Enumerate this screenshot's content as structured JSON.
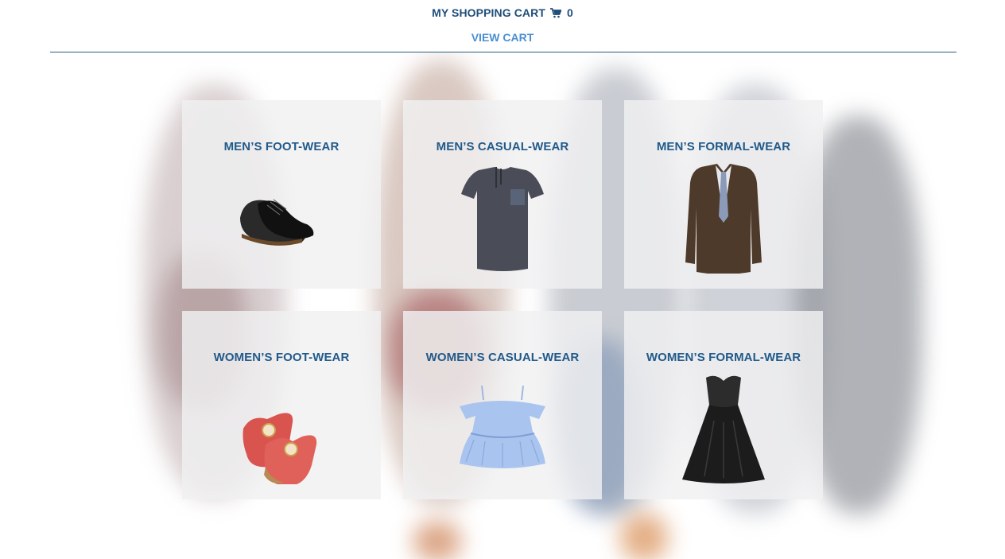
{
  "header": {
    "cart_label": "MY SHOPPING CART",
    "cart_icon": "shopping-cart-icon",
    "cart_count": "0",
    "view_cart_label": "VIEW CART"
  },
  "categories": [
    {
      "title": "MEN’S FOOT-WEAR",
      "image": "mens-shoes"
    },
    {
      "title": "MEN’S CASUAL-WEAR",
      "image": "mens-tshirt"
    },
    {
      "title": "MEN’S FORMAL-WEAR",
      "image": "mens-suit"
    },
    {
      "title": "WOMEN’S FOOT-WEAR",
      "image": "womens-shoes"
    },
    {
      "title": "WOMEN’S CASUAL-WEAR",
      "image": "womens-top"
    },
    {
      "title": "WOMEN’S FORMAL-WEAR",
      "image": "womens-gown"
    }
  ],
  "colors": {
    "header_text": "#1f4e79",
    "link": "#4a90d0",
    "card_title": "#215a8a"
  }
}
